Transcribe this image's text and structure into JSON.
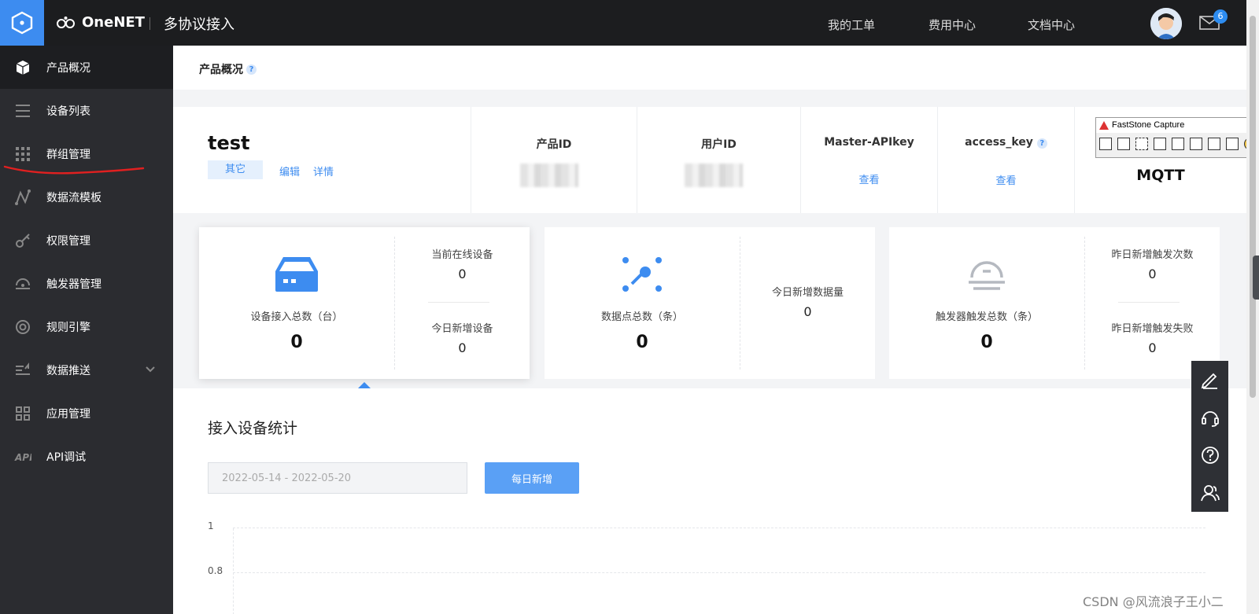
{
  "header": {
    "brand": "OneNET",
    "product": "多协议接入",
    "nav": [
      "我的工单",
      "费用中心",
      "文档中心"
    ],
    "mail_badge": "6"
  },
  "sidebar": {
    "items": [
      {
        "label": "产品概况",
        "icon": "cube-icon",
        "active": true
      },
      {
        "label": "设备列表",
        "icon": "list-icon"
      },
      {
        "label": "群组管理",
        "icon": "grid-dots-icon"
      },
      {
        "label": "数据流模板",
        "icon": "flow-icon"
      },
      {
        "label": "权限管理",
        "icon": "key-icon"
      },
      {
        "label": "触发器管理",
        "icon": "trigger-icon"
      },
      {
        "label": "规则引擎",
        "icon": "rule-icon"
      },
      {
        "label": "数据推送",
        "icon": "push-icon",
        "has_children": true
      },
      {
        "label": "应用管理",
        "icon": "apps-icon"
      },
      {
        "label": "API调试",
        "icon": "api-icon"
      }
    ]
  },
  "page": {
    "title": "产品概况"
  },
  "product_info": {
    "name": "test",
    "tag": "其它",
    "edit_link": "编辑",
    "detail_link": "详情",
    "columns": {
      "product_id": {
        "label": "产品ID"
      },
      "user_id": {
        "label": "用户ID"
      },
      "master_apikey": {
        "label": "Master-APIkey",
        "value": "查看"
      },
      "access_key": {
        "label": "access_key",
        "value": "查看"
      },
      "protocol": {
        "value": "MQTT"
      }
    }
  },
  "stats": {
    "device": {
      "label": "设备接入总数（台）",
      "total": "0",
      "online_label": "当前在线设备",
      "online": "0",
      "new_label": "今日新增设备",
      "new": "0"
    },
    "datapoint": {
      "label": "数据点总数（条）",
      "total": "0",
      "new_label": "今日新增数据量",
      "new": "0"
    },
    "trigger": {
      "label": "触发器触发总数（条）",
      "total": "0",
      "yesterday_label": "昨日新增触发次数",
      "yesterday": "0",
      "failed_label": "昨日新增触发失败",
      "failed": "0"
    }
  },
  "device_stats": {
    "title": "接入设备统计",
    "date_range": "2022-05-14 - 2022-05-20",
    "button": "每日新增",
    "y_ticks": [
      "1",
      "0.8"
    ]
  },
  "faststone": {
    "title": "FastStone Capture"
  },
  "watermark": "CSDN @风流浪子王小二",
  "colors": {
    "accent": "#3d8cf0",
    "topbar": "#1c1d1f",
    "sidebar": "#2b2c30",
    "annotation_red": "#e02020"
  }
}
